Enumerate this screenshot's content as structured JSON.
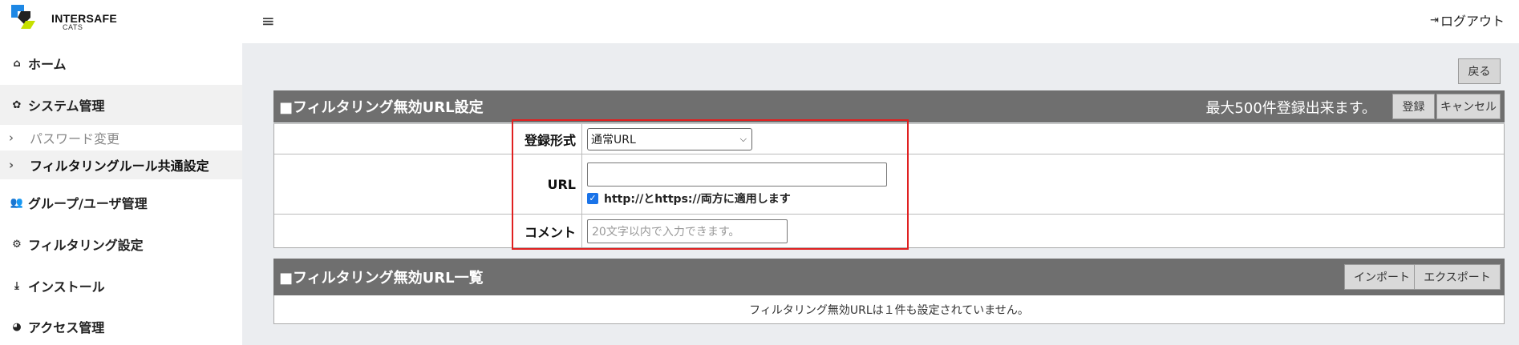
{
  "header": {
    "logo_text": "INTERSAFE",
    "logo_sub": "CATS",
    "logout_label": "ログアウト"
  },
  "sidebar": {
    "items": [
      {
        "label": "ホーム",
        "icon": "home-icon"
      },
      {
        "label": "システム管理",
        "icon": "gear-icon"
      },
      {
        "label": "グループ/ユーザ管理",
        "icon": "users-icon"
      },
      {
        "label": "フィルタリング設定",
        "icon": "cogs-icon"
      },
      {
        "label": "インストール",
        "icon": "download-icon"
      },
      {
        "label": "アクセス管理",
        "icon": "pie-chart-icon"
      }
    ],
    "sub_items": [
      {
        "label": "パスワード変更",
        "active": false
      },
      {
        "label": "フィルタリングルール共通設定",
        "active": true
      }
    ]
  },
  "main": {
    "back_label": "戻る",
    "settings_panel": {
      "title": "■フィルタリング無効URL設定",
      "limit_text": "最大500件登録出来ます。",
      "register_label": "登録",
      "cancel_label": "キャンセル",
      "rows": {
        "format_label": "登録形式",
        "format_selected": "通常URL",
        "url_label": "URL",
        "url_value": "",
        "apply_both_checked": true,
        "apply_both_label": "http://とhttps://両方に適用します",
        "comment_label": "コメント",
        "comment_placeholder": "20文字以内で入力できます。"
      }
    },
    "list_panel": {
      "title": "■フィルタリング無効URL一覧",
      "import_label": "インポート",
      "export_label": "エクスポート",
      "empty_message": "フィルタリング無効URLは１件も設定されていません。"
    }
  },
  "colors": {
    "panel_header": "#6f6f6f",
    "highlight": "#e02020",
    "background": "#ebedf0"
  }
}
